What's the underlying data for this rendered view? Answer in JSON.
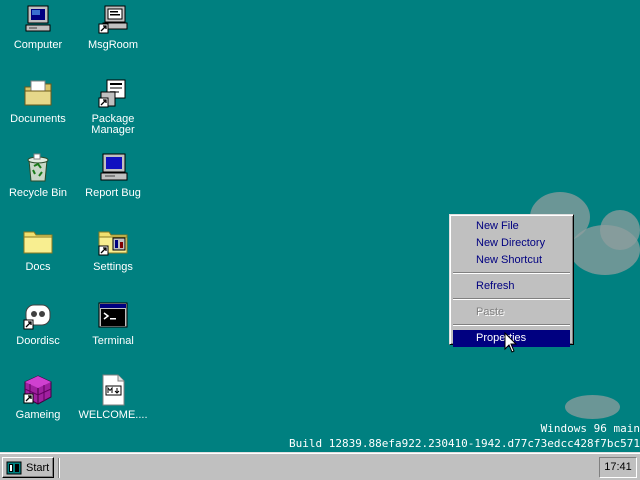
{
  "desktop": {
    "icons": [
      {
        "label": "Computer",
        "icon": "computer-icon"
      },
      {
        "label": "MsgRoom",
        "icon": "msgroom-icon"
      },
      {
        "label": "Documents",
        "icon": "documents-folder-icon"
      },
      {
        "label": "Package\nManager",
        "icon": "package-manager-icon"
      },
      {
        "label": "Recycle Bin",
        "icon": "recycle-bin-icon"
      },
      {
        "label": "Report Bug",
        "icon": "report-bug-icon"
      },
      {
        "label": "Docs",
        "icon": "folder-icon"
      },
      {
        "label": "Settings",
        "icon": "settings-folder-icon"
      },
      {
        "label": "Doordisc",
        "icon": "doordisc-icon"
      },
      {
        "label": "Terminal",
        "icon": "terminal-icon"
      },
      {
        "label": "Gameing",
        "icon": "game-cube-icon"
      },
      {
        "label": "WELCOME....",
        "icon": "markdown-file-icon"
      }
    ],
    "background_color": "#008080"
  },
  "context_menu": {
    "new_file": "New File",
    "new_directory": "New Directory",
    "new_shortcut": "New Shortcut",
    "refresh": "Refresh",
    "paste": "Paste",
    "properties": "Properties"
  },
  "watermark": {
    "line1": "Windows 96 main",
    "line2": "Build 12839.88efa922.230410-1942.d77c73edcc428f7bc571"
  },
  "taskbar": {
    "start_label": "Start",
    "clock": "17:41"
  },
  "colors": {
    "menu_text": "#000080",
    "menu_highlight": "#000080",
    "taskbar": "#c0c0c0"
  }
}
